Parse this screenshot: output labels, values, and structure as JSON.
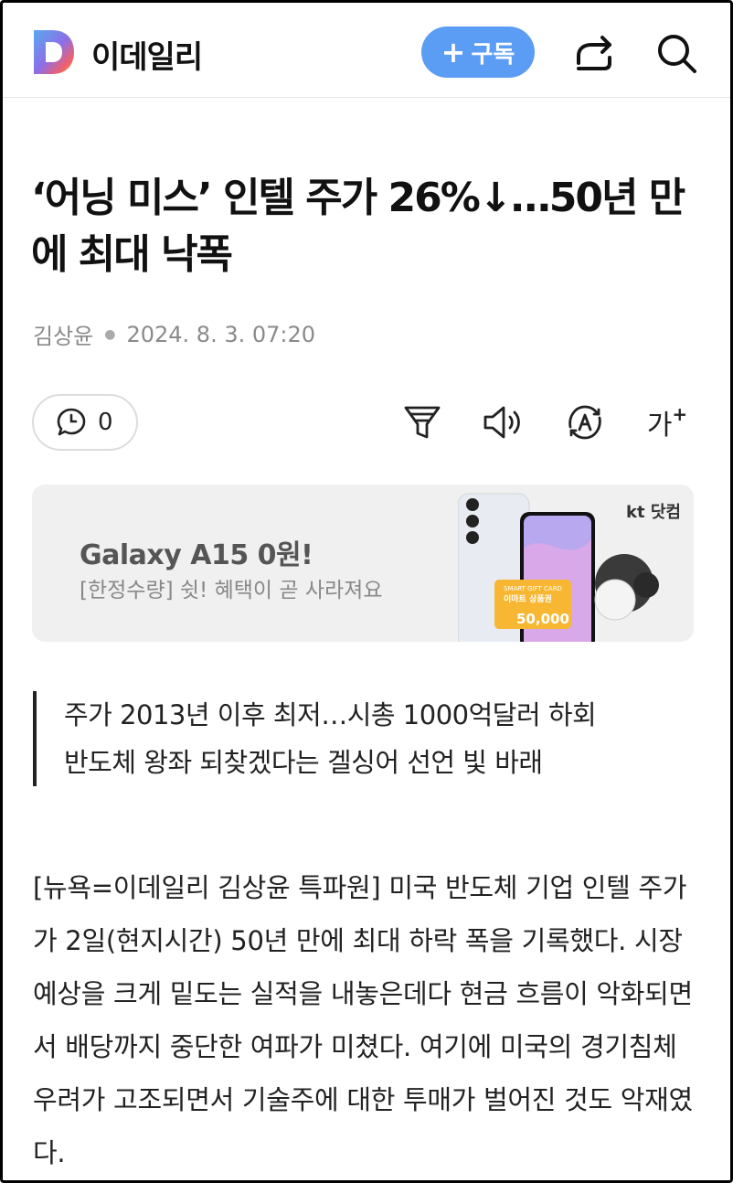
{
  "header": {
    "brand": "이데일리",
    "subscribe_label": "구독",
    "icons": [
      "logo-icon",
      "share-icon",
      "search-icon"
    ]
  },
  "article": {
    "title": "‘어닝 미스’ 인텔 주가 26%↓…50년 만에 최대 낙폭",
    "author": "김상윤",
    "date": "2024. 8. 3. 07:20",
    "comment_count": "0",
    "font_size_label": "가",
    "subtitle_lines": [
      "주가 2013년 이후 최저…시총 1000억달러 하회",
      "반도체 왕좌 되찾겠다는 겔싱어 선언 빛 바래"
    ],
    "body": "[뉴욕=이데일리 김상윤 특파원] 미국 반도체 기업 인텔 주가가 2일(현지시간) 50년 만에 최대 하락 폭을 기록했다. 시장 예상을 크게 밑도는 실적을 내놓은데다 현금 흐름이 악화되면서 배당까지 중단한 여파가 미쳤다. 여기에 미국의 경기침체 우려가 고조되면서 기술주에 대한 투매가 벌어진 것도 악재였다."
  },
  "ad": {
    "title": "Galaxy A15 0원!",
    "subtitle": "[한정수량] 쉿! 혜택이 곧 사라져요",
    "brand": "kt 닷컴",
    "card_label": "이마트 상품권",
    "card_value": "50,000"
  },
  "colors": {
    "accent": "#5b9cf4",
    "ad_background": "#f0f0f0",
    "card": "#f7b733"
  }
}
